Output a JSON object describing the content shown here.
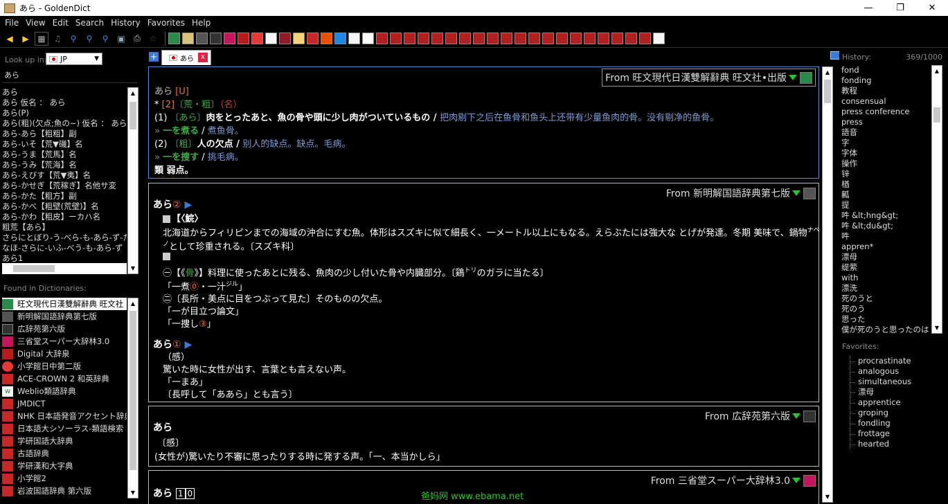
{
  "window": {
    "title": "あら - GoldenDict"
  },
  "menu": [
    "File",
    "View",
    "Edit",
    "Search",
    "History",
    "Favorites",
    "Help"
  ],
  "left": {
    "lookup_label": "Look up in:",
    "group": "JP",
    "query": "あら",
    "words": [
      "あら",
      "あら 仮名 ： あら",
      "あら(P)",
      "あら(粗)(欠点;魚の~) 仮名 ： あら",
      "あら-あら【粗粗】副",
      "あら-いそ【荒▼磯】名",
      "あら-うま【荒馬】名",
      "あら-うみ【荒海】名",
      "あら-えびす【荒▼夷】名",
      "あら-かせぎ【荒稼ぎ】名他サ変",
      "あら-かた【粗方】副",
      "あら-かべ【粗壁(荒壁)】名",
      "あら-かわ【粗皮】ーカハ名",
      "粗荒【あら】",
      "さらにとぼり-う-べら-も-あら-ず-たちこ",
      "なほ-さらに-いふ-べう-も-あら-ず【なほ",
      "あら1"
    ],
    "found_label": "Found in Dictionaries:",
    "dicts": [
      "旺文現代日漢雙解辭典 旺文社",
      "新明解国語辞典第七版",
      "広辞苑第六版",
      "三省堂スーパー大辞林3.0",
      "Digital 大辞泉",
      "小学館日中第二版",
      "ACE-CROWN 2 和英辞典",
      "Weblio類語辞典",
      "JMDICT",
      "NHK 日本語発音アクセント辞典",
      "日本語大シソーラス-類語検索",
      "学研国語大辞典",
      "古語辞典",
      "学研漢和大字典",
      "小学館2",
      "岩波国語辞典 第六版"
    ]
  },
  "tab": {
    "label": "あら",
    "close": "x"
  },
  "articles": {
    "a1": {
      "from": "From 旺文現代日漢雙解辭典 旺文社•出版",
      "l1a": "あら",
      "l1b": "[U]",
      "l2a": "* ",
      "l2b": "[2]",
      "l2c": "〔荒・粗〕",
      "l2d": "（名）",
      "l3a": "(1) ",
      "l3b": "〔あら〕",
      "l3c": "肉をとったあと、魚の骨や頭に少し肉がついているもの / ",
      "l3d": "把肉剔下之后在鱼骨和鱼头上还带有少量鱼肉的骨。没有剔净的鱼骨。",
      "l4a": "» ",
      "l4b": "一を煮る",
      "l4c": " / ",
      "l4d": "煮鱼骨。",
      "l5a": "(2) ",
      "l5b": "〔粗〕",
      "l5c": "人の欠点 / ",
      "l5d": "别人的缺点。缺点。毛病。",
      "l6a": "» ",
      "l6b": "一を捜す",
      "l6c": " / ",
      "l6d": "挑毛病。",
      "l7": "類 弱点。"
    },
    "a2": {
      "from": "From 新明解国語辞典第七版",
      "head": "あら",
      "num": "②",
      "l1": "【〈鯇〉",
      "l2": "北海道からフィリピンまでの海域の沖合にすむ魚。体形はスズキに似て細長く、一メートル以上にもなる。えらぶたには強大な とげが発達。冬期 美味で、鍋物",
      "l2r": "ナベモ",
      "l3": "ノ",
      "l3b": "として珍重される。〔スズキ科〕",
      "l4a": "㊀【《",
      "l4b": "骨",
      "l4c": "》】料理に使ったあとに残る、魚肉の少し付いた骨や内臓部分。〔鶏",
      "l4r": "トリ",
      "l4d": "のガラに当たる〕",
      "l5a": "「一煮",
      "l5b": "⓪",
      "l5c": "・一汁",
      "l5r": "ジル",
      "l5d": "」",
      "l6": "㊁〔長所・美点に目をつぶって見た〕そのものの欠点。",
      "l7": "「一が目立つ論文」",
      "l8a": "「一捜し",
      "l8b": "③",
      "l8c": "」",
      "head2": "あら",
      "num2": "①",
      "l9": "（感）",
      "l10": "驚いた時に女性が出す、言葉とも言えない声。",
      "l11": "「一まあ」",
      "l12": "〔長呼して「ああら」とも言う〕"
    },
    "a3": {
      "from": "From 広辞苑第六版",
      "head": "あら",
      "l1": "〔感〕",
      "l2": "(女性が)驚いたり不審に思ったりする時に発する声。「一、本当かしら」"
    },
    "a4": {
      "from": "From 三省堂スーパー大辞林3.0",
      "head": "あら",
      "n1": "1",
      "n2": "0"
    }
  },
  "history": {
    "label": "History:",
    "count": "369/1000",
    "items": [
      "fond",
      "fonding",
      "教程",
      "consensual",
      "press conference",
      "press",
      "語音",
      "字",
      "字体",
      "操作",
      "锌",
      "楢",
      "瓤",
      "提",
      "吽 &lt;hng&gt;",
      "吽 &lt;du&gt;",
      "吽",
      "appren*",
      "漂母",
      "缇萦",
      "with",
      "漂洗",
      "死のうと",
      "死のう",
      "思った",
      "僕が死のうと思ったのは"
    ]
  },
  "favorites": {
    "label": "Favorites:",
    "items": [
      "procrastinate",
      "analogous",
      "simultaneous",
      "漂母",
      "apprentice",
      "groping",
      "fondling",
      "frottage",
      "hearted"
    ]
  },
  "watermark": "爸妈网 www.ebama.net"
}
